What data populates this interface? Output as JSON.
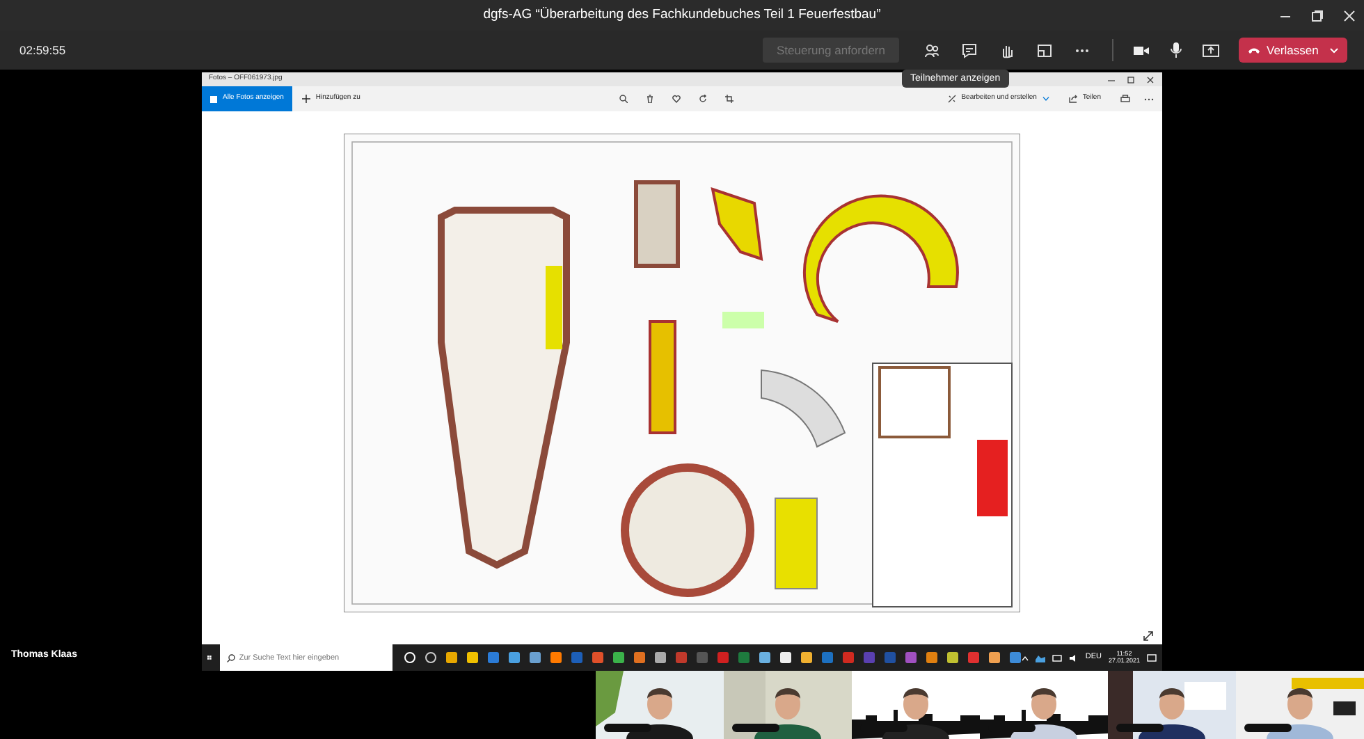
{
  "window": {
    "title": "dgfs-AG “Überarbeitung des Fachkundebuches Teil 1 Feuerfestbau”"
  },
  "call_toolbar": {
    "timer": "02:59:55",
    "request_control": {
      "label": "Steuerung anfordern",
      "disabled": true
    },
    "leave": {
      "label": "Verlassen"
    }
  },
  "tooltip": "Teilnehmer anzeigen",
  "shared_screen": {
    "app_title": "Fotos – OFF061973.jpg",
    "all_photos": "Alle Fotos anzeigen",
    "add_to": "Hinzufügen zu",
    "edit_create": "Bearbeiten und erstellen",
    "share": "Teilen",
    "taskbar": {
      "search_placeholder": "Zur Suche Text hier eingeben",
      "language": "DEU",
      "time": "11:52",
      "date": "27.01.2021"
    }
  },
  "presenter_name": "Thomas Klaas"
}
